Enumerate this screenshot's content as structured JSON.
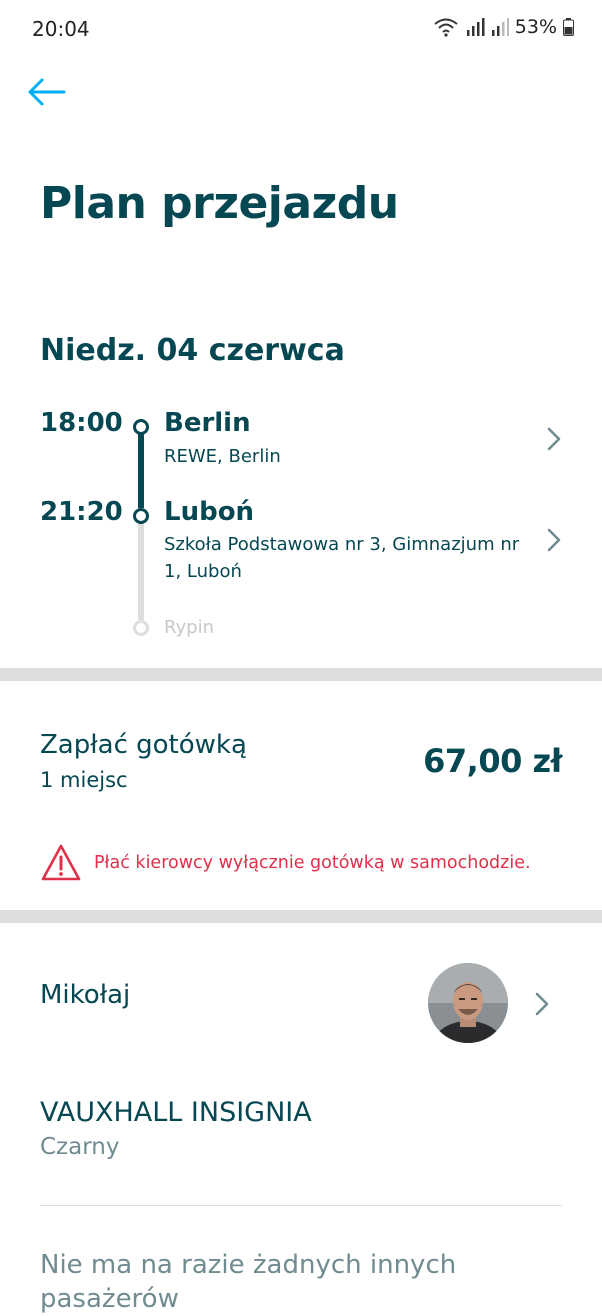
{
  "status_bar": {
    "time": "20:04",
    "battery": "53%"
  },
  "header": {
    "title": "Plan przejazdu"
  },
  "trip": {
    "date": "Niedz. 04 czerwca",
    "stops": [
      {
        "time": "18:00",
        "city": "Berlin",
        "address": "REWE, Berlin"
      },
      {
        "time": "21:20",
        "city": "Luboń",
        "address": "Szkoła Podstawowa nr 3, Gimnazjum nr 1, Luboń"
      }
    ],
    "final_stop": "Rypin"
  },
  "payment": {
    "title": "Zapłać gotówką",
    "seats": "1 miejsc",
    "price": "67,00 zł",
    "warning": "Płać kierowcy wyłącznie gotówką w samochodzie."
  },
  "driver": {
    "name": "Mikołaj"
  },
  "car": {
    "model": "VAUXHALL INSIGNIA",
    "color": "Czarny"
  },
  "passengers": {
    "empty_text": "Nie ma na razie żadnych innych pasażerów"
  },
  "colors": {
    "primary": "#054752",
    "accent": "#00AFF5",
    "warning": "#E0304A",
    "muted": "#708C91"
  }
}
